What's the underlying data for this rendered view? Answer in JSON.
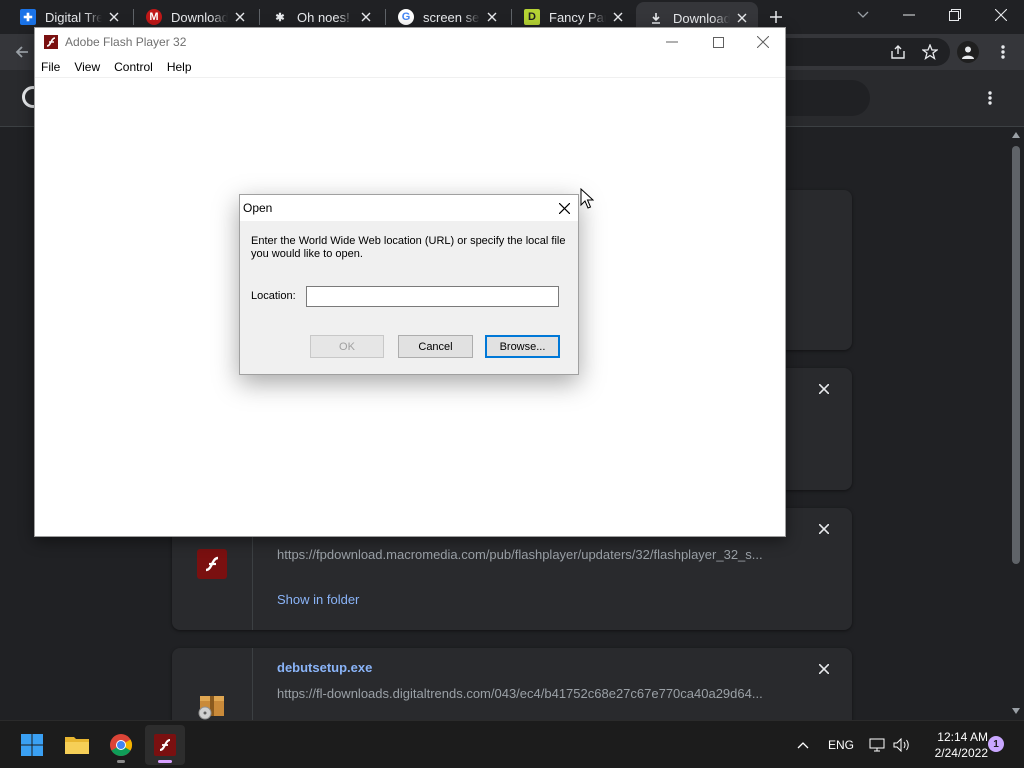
{
  "browser": {
    "tabs": [
      {
        "title": "Digital Trends",
        "favicon": "digital-trends-icon",
        "favicon_color": "#1a73e8"
      },
      {
        "title": "Download",
        "favicon": "mcafee-icon",
        "favicon_color": "#c01818"
      },
      {
        "title": "Oh noes!",
        "favicon": "bug-icon",
        "favicon_color": "#e8eaed"
      },
      {
        "title": "screen settings",
        "favicon": "google-icon",
        "favicon_color": "#4285f4"
      },
      {
        "title": "Fancy Pants",
        "favicon": "fancy-pants-icon",
        "favicon_color": "#b5d334"
      },
      {
        "title": "Downloads",
        "favicon": "download-icon",
        "favicon_color": "#e8eaed"
      }
    ],
    "active_tab": "Downloads"
  },
  "downloads": {
    "items": [
      {
        "filename": "",
        "url": "https://fpdownload.macromedia.com/pub/flashplayer/updaters/32/flashplayer_32_s...",
        "action": "Show in folder",
        "icon": "flash-icon"
      },
      {
        "filename": "debutsetup.exe",
        "url": "https://fl-downloads.digitaltrends.com/043/ec4/b41752c68e27c67e770ca40a29d64...",
        "icon": "installer-icon"
      }
    ]
  },
  "flash_window": {
    "title": "Adobe Flash Player 32",
    "menu": [
      "File",
      "View",
      "Control",
      "Help"
    ]
  },
  "open_dialog": {
    "title": "Open",
    "message": "Enter the World Wide Web location (URL) or specify the local file you would like to open.",
    "location_label": "Location:",
    "location_value": "",
    "ok_label": "OK",
    "cancel_label": "Cancel",
    "browse_label": "Browse..."
  },
  "taskbar": {
    "language": "ENG",
    "time": "12:14 AM",
    "date": "2/24/2022",
    "notification_count": "1"
  }
}
